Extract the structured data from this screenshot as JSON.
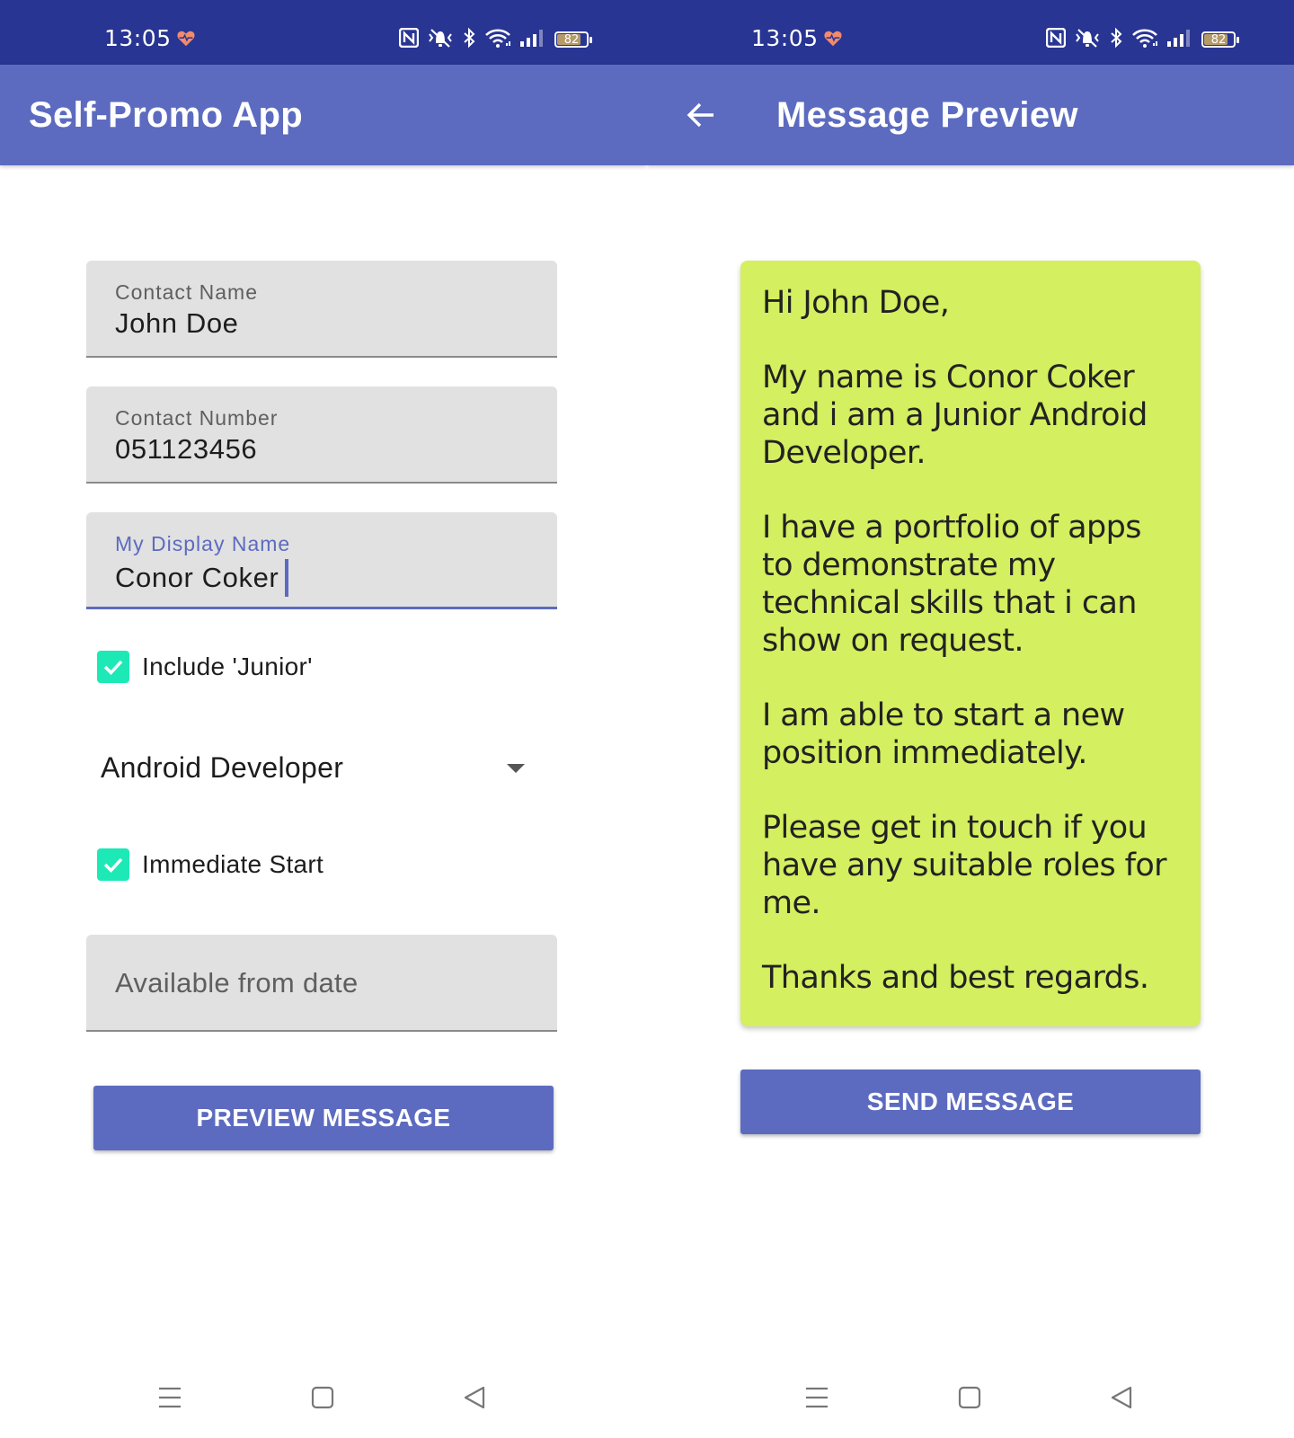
{
  "status_bar": {
    "time": "13:05",
    "battery_level": "82",
    "battery_fraction": 0.82,
    "icons": [
      "health-heart-icon",
      "nfc-icon",
      "vibrate-off-icon",
      "bluetooth-icon",
      "wifi-icon",
      "signal-icon",
      "battery-icon"
    ]
  },
  "colors": {
    "status_bar": "#283593",
    "app_bar": "#5c6bc0",
    "accent": "#1de9b6",
    "message_card": "#d4ef5f"
  },
  "left_screen": {
    "app_bar": {
      "title": "Self-Promo App"
    },
    "contact_name": {
      "label": "Contact Name",
      "value": "John Doe"
    },
    "contact_number": {
      "label": "Contact Number",
      "value": "051123456"
    },
    "display_name": {
      "label": "My Display Name",
      "value": "Conor Coker"
    },
    "include_junior": {
      "label": "Include 'Junior'",
      "checked": true
    },
    "job_title": {
      "selected": "Android Developer"
    },
    "immediate_start": {
      "label": "Immediate Start",
      "checked": true
    },
    "start_date": {
      "placeholder": "Available from date",
      "value": ""
    },
    "preview_button": {
      "label": "PREVIEW MESSAGE"
    }
  },
  "right_screen": {
    "app_bar": {
      "title": "Message Preview",
      "back_icon": "arrow-left-icon"
    },
    "message": {
      "greeting": "Hi John Doe,",
      "intro": "My name is Conor Coker and i am a Junior Android Developer.",
      "portfolio": "I have a portfolio of apps to demonstrate my technical skills that i can show on request.",
      "availability": "I am able to start a new position immediately.",
      "request": "Please get in touch if you have any suitable roles for me.",
      "signoff": "Thanks and best regards."
    },
    "send_button": {
      "label": "SEND MESSAGE"
    }
  },
  "nav_bar": {
    "icons": [
      "menu-icon",
      "home-square-icon",
      "back-triangle-icon"
    ]
  }
}
